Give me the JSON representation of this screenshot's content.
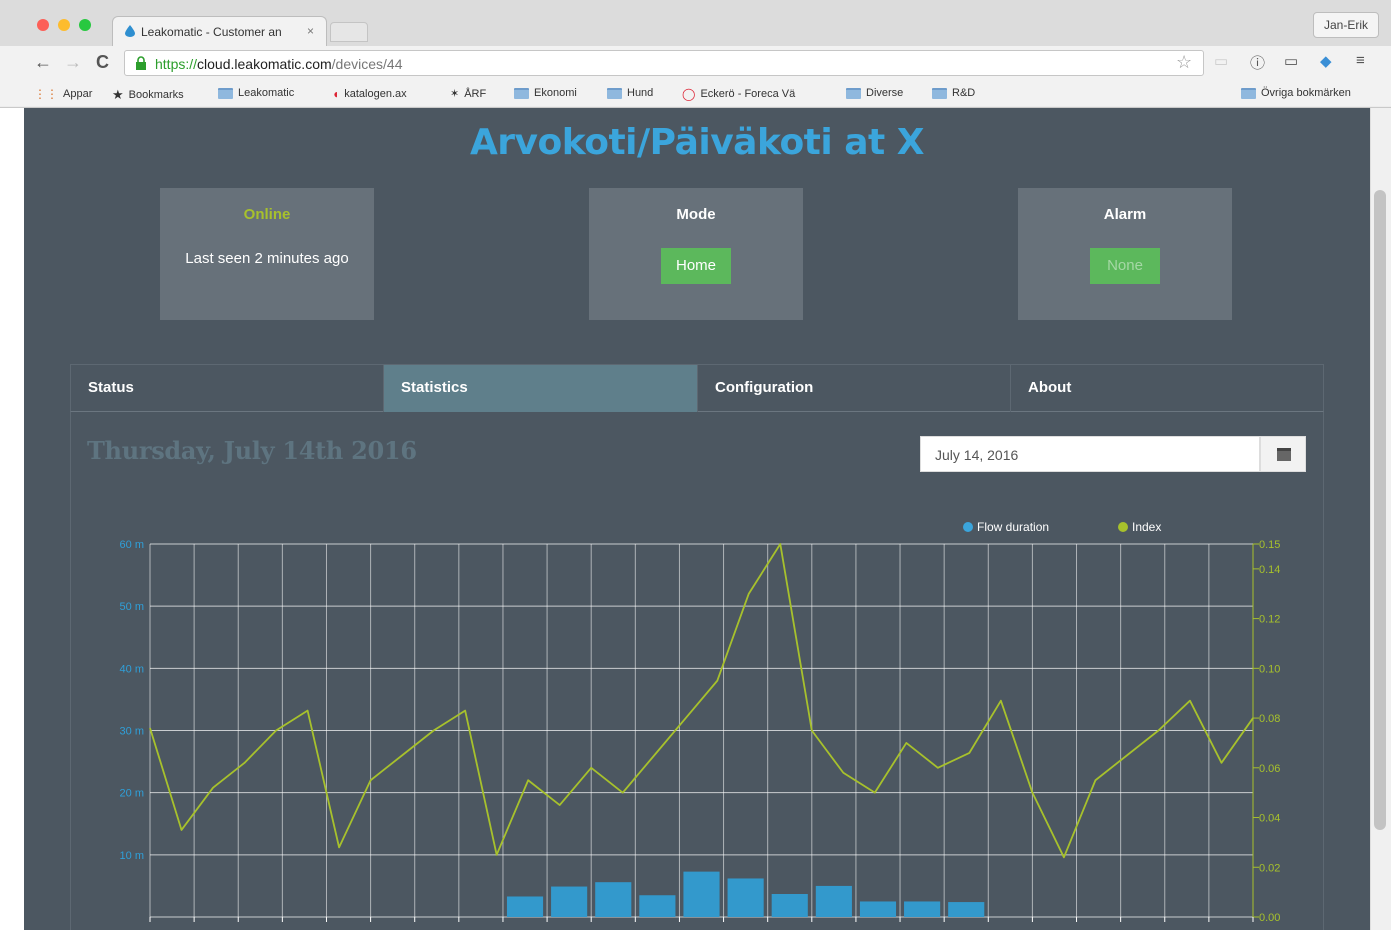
{
  "browser": {
    "tab_title": "Leakomatic - Customer an",
    "tab_close": "×",
    "profile_name": "Jan-Erik",
    "url_scheme": "https://",
    "url_host": "cloud.leakomatic.com",
    "url_path": "/devices/44",
    "bookmarks": [
      {
        "label": "Appar",
        "icon": "apps-grid-icon"
      },
      {
        "label": "Bookmarks",
        "icon": "star-icon"
      },
      {
        "label": "Leakomatic",
        "icon": "folder-icon"
      },
      {
        "label": "katalogen.ax",
        "icon": "site-icon"
      },
      {
        "label": "ÅRF",
        "icon": "site-icon"
      },
      {
        "label": "Ekonomi",
        "icon": "folder-icon"
      },
      {
        "label": "Hund",
        "icon": "folder-icon"
      },
      {
        "label": "Eckerö - Foreca Vä",
        "icon": "site-icon"
      },
      {
        "label": "Diverse",
        "icon": "folder-icon"
      },
      {
        "label": "R&D",
        "icon": "folder-icon"
      }
    ],
    "other_bookmarks": "Övriga bokmärken"
  },
  "page": {
    "title": "Arvokoti/Päiväkoti at X",
    "status_card": {
      "head": "Online",
      "text": "Last seen 2 minutes ago",
      "head_color": "#a7c12c"
    },
    "mode_card": {
      "head": "Mode",
      "value": "Home"
    },
    "alarm_card": {
      "head": "Alarm",
      "value": "None"
    },
    "tabs": [
      {
        "label": "Status",
        "active": false
      },
      {
        "label": "Statistics",
        "active": true
      },
      {
        "label": "Configuration",
        "active": false
      },
      {
        "label": "About",
        "active": false
      }
    ],
    "date_heading": "Thursday, July 14th 2016",
    "date_input_value": "July 14, 2016"
  },
  "colors": {
    "background": "#4c5761",
    "accent_blue": "#3ba5dc",
    "index_green": "#a7c12c",
    "mode_green": "#5cb85c"
  },
  "chart_data": {
    "type": "bar+line",
    "legend": [
      "Flow duration",
      "Index"
    ],
    "legend_placement": "top-right",
    "grid": true,
    "y_left": {
      "ticks": [
        "60 m",
        "50 m",
        "40 m",
        "30 m",
        "20 m",
        "10 m"
      ],
      "range_minutes": [
        0,
        60
      ]
    },
    "y_right": {
      "ticks": [
        "0.15",
        "0.14",
        "0.12",
        "0.10",
        "0.08",
        "0.06",
        "0.04",
        "0.02",
        "0.00"
      ],
      "range": [
        0,
        0.15
      ]
    },
    "x_categories": 25,
    "series": [
      {
        "name": "Flow duration",
        "kind": "bar",
        "unit": "minutes",
        "values": [
          0,
          0,
          0,
          0,
          0,
          0,
          0,
          0,
          3.3,
          4.9,
          5.6,
          3.5,
          7.3,
          6.2,
          3.7,
          5.0,
          2.5,
          2.5,
          2.4,
          0,
          0,
          0,
          0,
          0,
          0
        ]
      },
      {
        "name": "Index",
        "kind": "line",
        "values": [
          0.076,
          0.035,
          0.052,
          0.062,
          0.075,
          0.083,
          0.028,
          0.055,
          0.065,
          0.075,
          0.083,
          0.025,
          0.055,
          0.045,
          0.06,
          0.05,
          0.065,
          0.08,
          0.095,
          0.13,
          0.15,
          0.075,
          0.058,
          0.05,
          0.07,
          0.06,
          0.066,
          0.087,
          0.05,
          0.024,
          0.055,
          0.065,
          0.075,
          0.087,
          0.062,
          0.08
        ]
      }
    ]
  }
}
